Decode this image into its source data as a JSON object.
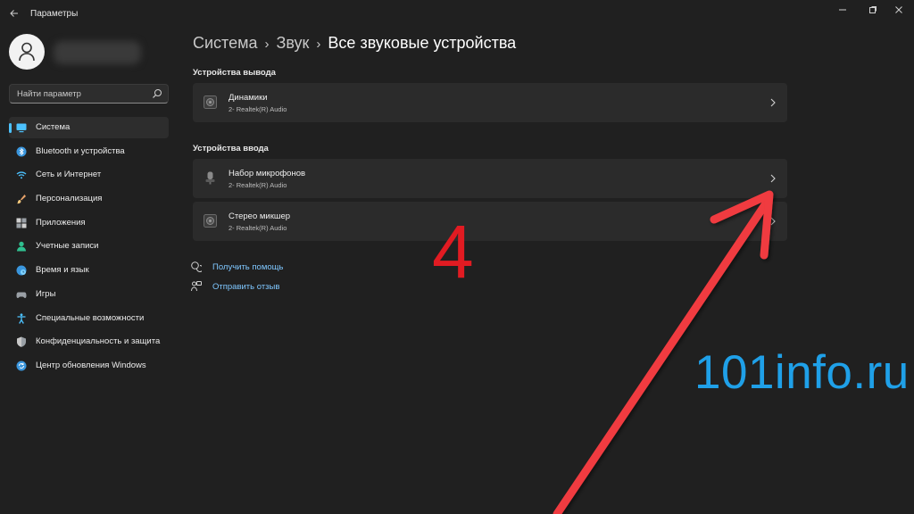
{
  "window": {
    "title": "Параметры",
    "controls": [
      "minimize-icon",
      "maximize-icon",
      "close-icon"
    ]
  },
  "search": {
    "placeholder": "Найти параметр"
  },
  "sidebar": {
    "items": [
      {
        "label": "Система",
        "icon": "monitor-icon",
        "active": true
      },
      {
        "label": "Bluetooth и устройства",
        "icon": "bluetooth-icon"
      },
      {
        "label": "Сеть и Интернет",
        "icon": "wifi-icon"
      },
      {
        "label": "Персонализация",
        "icon": "brush-icon"
      },
      {
        "label": "Приложения",
        "icon": "apps-icon"
      },
      {
        "label": "Учетные записи",
        "icon": "account-icon"
      },
      {
        "label": "Время и язык",
        "icon": "globe-clock-icon"
      },
      {
        "label": "Игры",
        "icon": "gamepad-icon"
      },
      {
        "label": "Специальные возможности",
        "icon": "accessibility-icon"
      },
      {
        "label": "Конфиденциальность и защита",
        "icon": "shield-icon"
      },
      {
        "label": "Центр обновления Windows",
        "icon": "update-icon"
      }
    ]
  },
  "breadcrumb": {
    "items": [
      "Система",
      "Звук"
    ],
    "current": "Все звуковые устройства",
    "separator": "›"
  },
  "output": {
    "section_title": "Устройства вывода",
    "devices": [
      {
        "name": "Динамики",
        "detail": "2- Realtek(R) Audio",
        "icon": "speaker-icon"
      }
    ]
  },
  "input": {
    "section_title": "Устройства ввода",
    "devices": [
      {
        "name": "Набор микрофонов",
        "detail": "2- Realtek(R) Audio",
        "icon": "microphone-icon"
      },
      {
        "name": "Стерео микшер",
        "detail": "2- Realtek(R) Audio",
        "icon": "speaker-icon"
      }
    ]
  },
  "links": {
    "help": "Получить помощь",
    "feedback": "Отправить отзыв"
  },
  "overlay": {
    "step_number": "4",
    "watermark": "101info.ru",
    "accent_red": "#e11b22",
    "watermark_blue": "#1fa0e8"
  },
  "colors": {
    "background": "#202020",
    "card": "#2b2b2b",
    "accent": "#4cc2ff",
    "link": "#7fc7ff"
  }
}
